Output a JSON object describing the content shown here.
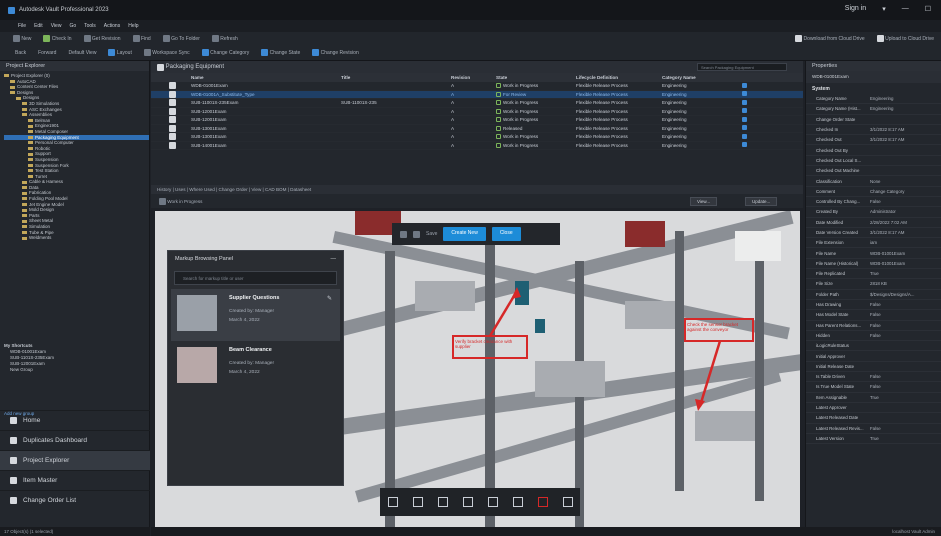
{
  "window": {
    "title": "Autodesk Vault Professional 2023",
    "user": "Sign in",
    "controls": [
      "▾",
      "—",
      "☐"
    ]
  },
  "menu": [
    "File",
    "Edit",
    "View",
    "Go",
    "Tools",
    "Actions",
    "Help"
  ],
  "toolbar1": [
    "New",
    "Check In",
    "Get Revision",
    "Find",
    "Go To Folder",
    "Refresh",
    "Download from Cloud Drive",
    "Upload to Cloud Drive"
  ],
  "toolbar2": [
    "Back",
    "Forward",
    "Default View",
    "Layout",
    "Workspace Sync",
    "Change Category",
    "Change State",
    "Change Revision"
  ],
  "left": {
    "header": "Project Explorer",
    "tree": [
      "Project Explorer (0)",
      "AutoCAD",
      "Content Center Files",
      "Designs",
      "Designs",
      "3D Simulations",
      "ASC Exchanges",
      "Assemblies",
      "Belman",
      "Engine1901",
      "Metal Composer",
      "Packaging Equipment",
      "Personal Computer",
      "Robotic",
      "Support",
      "Suspension",
      "Suspension Fork",
      "Test Station",
      "Turret",
      "Cable & Harness",
      "Data",
      "Fabrication",
      "Folding Pool Model",
      "Jet Engine Model",
      "Mold Design",
      "Parts",
      "Sheet Metal",
      "Simulation",
      "Tube & Pipe",
      "Weldments"
    ],
    "shortcuts_head": "My Shortcuts",
    "shortcuts": [
      "WDB-01001Exam",
      "SUB-1101S-235Exam",
      "SUB-12001Exam",
      "New Group"
    ],
    "add": "Add new group",
    "nav": [
      "Home",
      "Duplicates Dashboard",
      "Project Explorer",
      "Item Master",
      "Change Order List"
    ],
    "status": "17 Object(s) (1 selected)"
  },
  "grid": {
    "title": "Packaging Equipment",
    "search_placeholder": "Search Packaging Equipment",
    "columns": [
      "Name",
      "Title",
      "Revision",
      "State",
      "Lifecycle Definition",
      "Category Name"
    ],
    "rows": [
      {
        "name": "WDB-01001Exam",
        "title": "",
        "rev": "A",
        "state": "Work in Progress",
        "lc": "Flexible Release Process",
        "cat": "Engineering"
      },
      {
        "name": "WDB-01001A_Substitute_Type",
        "title": "",
        "rev": "A",
        "state": "For Review",
        "lc": "Flexible Release Process",
        "cat": "Engineering"
      },
      {
        "name": "SUB-11001S-235Exam",
        "title": "SUB-11001S-235",
        "rev": "A",
        "state": "Work in Progress",
        "lc": "Flexible Release Process",
        "cat": "Engineering"
      },
      {
        "name": "SUB-12001Exam",
        "title": "",
        "rev": "A",
        "state": "Work in Progress",
        "lc": "Flexible Release Process",
        "cat": "Engineering"
      },
      {
        "name": "SUB-12001Exam",
        "title": "",
        "rev": "A",
        "state": "Work in Progress",
        "lc": "Flexible Release Process",
        "cat": "Engineering"
      },
      {
        "name": "SUB-13001Exam",
        "title": "",
        "rev": "A",
        "state": "Released",
        "lc": "Flexible Release Process",
        "cat": "Engineering"
      },
      {
        "name": "SUB-13001Exam",
        "title": "",
        "rev": "A",
        "state": "Work in Progress",
        "lc": "Flexible Release Process",
        "cat": "Engineering"
      },
      {
        "name": "SUB-14001Exam",
        "title": "",
        "rev": "A",
        "state": "Work in Progress",
        "lc": "Flexible Release Process",
        "cat": "Engineering"
      }
    ]
  },
  "tabs": "History | Uses | Where Used | Change Order | View | CAD BOM | Datasheet",
  "viewbar": {
    "state": "Work in Progress",
    "btn_view": "View...",
    "btn_update": "Update..."
  },
  "markup_panel": {
    "title": "Markup Browsing Panel",
    "search": "Search for markup title or user",
    "items": [
      {
        "title": "Supplier Questions",
        "by": "Created by: Manager",
        "date": "March 4, 2022"
      },
      {
        "title": "Beam Clearance",
        "by": "Created by: Manager",
        "date": "March 4, 2022"
      }
    ]
  },
  "canvas": {
    "create": "Create New",
    "close": "Close",
    "save": "Save",
    "callout_left": "Verify bracket clearance with supplier",
    "callout_right": "Check the sensor bracket against the conveyor"
  },
  "properties": {
    "header": "Properties",
    "file": "WDB-01001Exam",
    "section": "System",
    "rows": [
      [
        "Category Name",
        "Engineering"
      ],
      [
        "Category Name (Hist...",
        "Engineering"
      ],
      [
        "Change Order State",
        ""
      ],
      [
        "Checked In",
        "3/1/2022 8:17 AM"
      ],
      [
        "Checked Out",
        "3/1/2022 8:17 AM"
      ],
      [
        "Checked Out By",
        ""
      ],
      [
        "Checked Out Local S...",
        ""
      ],
      [
        "Checked Out Machine",
        ""
      ],
      [
        "Classification",
        "None"
      ],
      [
        "Comment",
        "Change Category"
      ],
      [
        "Controlled By Chang...",
        "False"
      ],
      [
        "Created By",
        "Administrator"
      ],
      [
        "Date Modified",
        "2/28/2022 7:02 AM"
      ],
      [
        "Date Version Created",
        "3/1/2022 8:17 AM"
      ],
      [
        "File Extension",
        "iam"
      ],
      [
        "File Name",
        "WDB-01001Exam"
      ],
      [
        "File Name (Historical)",
        "WDB-01001Exam"
      ],
      [
        "File Replicated",
        "True"
      ],
      [
        "File Size",
        "2818 KB"
      ],
      [
        "Folder Path",
        "$/Designs/Designs/A..."
      ],
      [
        "Has Drawing",
        "False"
      ],
      [
        "Has Model State",
        "False"
      ],
      [
        "Has Parent Relations...",
        "False"
      ],
      [
        "Hidden",
        "False"
      ],
      [
        "iLogicRuleStatus",
        ""
      ],
      [
        "Initial Approver",
        ""
      ],
      [
        "Initial Release Date",
        ""
      ],
      [
        "Is Table Driven",
        "False"
      ],
      [
        "Is True Model State",
        "False"
      ],
      [
        "Item Assignable",
        "True"
      ],
      [
        "Latest Approver",
        ""
      ],
      [
        "Latest Released Date",
        ""
      ],
      [
        "Latest Released Revis...",
        "False"
      ],
      [
        "Latest Version",
        "True"
      ]
    ]
  },
  "status": {
    "left": "",
    "right": "localhost  Vault  Admin"
  }
}
